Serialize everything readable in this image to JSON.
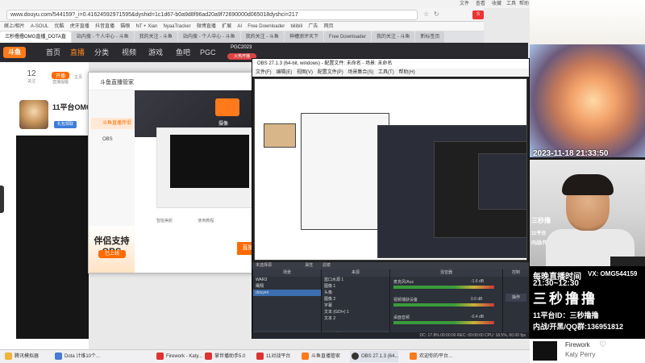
{
  "browser": {
    "top_menu": [
      "文件",
      "查看",
      "收藏",
      "工具",
      "帮助"
    ],
    "url": "www.douyu.com/544159?_i=0.41624592971595&dyshid=1c1d67-b0a9d8f96ad20a9f72690000d065018dyshci=217",
    "search_badge": "S",
    "bookmarks": [
      "嫁上/相片",
      "A-SOUL",
      "优酷",
      "虎牙直播",
      "抖音直播",
      "猫眼",
      "NT + Xian",
      "NyaaTracker",
      "微博直播",
      "扩展",
      "AI",
      "Free Downloader",
      "bilibili",
      "广告",
      "网页"
    ],
    "tabs": [
      "三秒撸撸OMG直播_DOTA直",
      "站内搜 - 个人中心 - 斗鱼",
      "我的关注 - 斗鱼",
      "站内搜 - 个人中心 - 斗鱼",
      "我的关注 - 斗鱼",
      "神槽测评天下",
      "Free Downloader",
      "我的关注 - 斗鱼",
      "新标签页"
    ]
  },
  "site_nav": {
    "logo": "斗鱼",
    "items": [
      "首页",
      "直播",
      "分类",
      "视频",
      "游戏",
      "鱼吧",
      "PGC"
    ],
    "active": "直播",
    "pgc_tag": "PGC2023",
    "pgc_badge": "火热开播"
  },
  "page": {
    "col1_num": "12",
    "col1_label": "关注",
    "col2_num": "开播",
    "col2_label": "直播提醒",
    "col3_label": "主页",
    "streamer_title": "11平台OMG",
    "streamer_tag": "礼包领取"
  },
  "assistant": {
    "title": "斗鱼直播管家",
    "sidebar": [
      "斗鱼直播伴侣",
      "OBS"
    ],
    "selected": "斗鱼直播伴侣",
    "banner_title": "伴侣支持OBS",
    "banner_btn": "已上线",
    "tools": [
      "智能美颜",
      "使用教程"
    ],
    "start_btn": "直播",
    "camera_label": "摄像"
  },
  "obs": {
    "title": "OBS 27.1.3 (64-bit, windows) - 配置文件: 未命名 - 场景: 未命名",
    "menu": [
      "文件(F)",
      "编辑(E)",
      "视图(V)",
      "配置文件(P)",
      "场景集合(S)",
      "工具(T)",
      "帮助(H)"
    ],
    "status_left": "未选择源",
    "status_props": "属性",
    "status_filters": "滤镜",
    "scenes_header": "场景",
    "scenes": [
      "WAR3",
      "鹰翔",
      "douyen"
    ],
    "selected_scene": "douyen",
    "sources_header": "来源",
    "sources": [
      "蓝口水源 1",
      "图像 1",
      "头像",
      "图像 2",
      "字幕",
      "文本 (GDI+) 1",
      "文本 2"
    ],
    "mixer_header": "混音器",
    "mixer": [
      "麦克风/Aux",
      "视频捕获设备",
      "桌面音频"
    ],
    "mixer_db": [
      "-1.6 dB",
      "0.0 dB",
      "-0.4 dB"
    ],
    "bottom_status": "DC: 17.8%   00:00:00   REC: 00:00:00   CPU: 18.5%, 60.00 fps",
    "controls_label": "控制",
    "right_btn": "操作"
  },
  "webcam": {
    "datetime": "2023-11-18 21:33:50",
    "time_label": "每晚直播时间",
    "vx": "VX: OMG544159",
    "time_range": "21:30~12:30",
    "name": "三秒撸撸",
    "platform_line": "11平台ID：三秒撸撸",
    "qq_line": "内战/开黑/QQ群:136951812",
    "overlay_small": "三秒撸",
    "overlay_small2": "11平台",
    "overlay_small3": "内战/开"
  },
  "music": {
    "song": "Firework",
    "artist": "Katy Perry",
    "heart": "♡"
  },
  "taskbar": [
    "腾讯模拟器",
    "Dota 计维10个...",
    "Firework - Katy...",
    "掌世播助手5.0",
    "11对战平台",
    "斗鱼直播管家",
    "OBS 27.1.3 (64...",
    "欢迎你的平台..."
  ],
  "colors": {
    "accent": "#ff6a00",
    "nav_bg": "#2a2a2f",
    "obs_bg": "#2b2e38"
  }
}
